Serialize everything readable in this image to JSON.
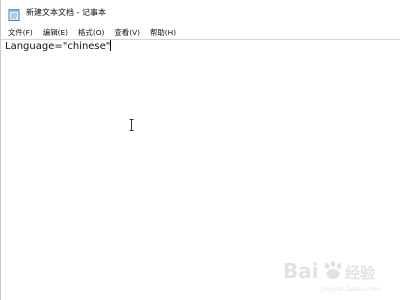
{
  "window": {
    "title": "新建文本文档 - 记事本"
  },
  "menu": {
    "items": [
      {
        "id": "file",
        "label": "文件(F)"
      },
      {
        "id": "edit",
        "label": "编辑(E)"
      },
      {
        "id": "format",
        "label": "格式(O)"
      },
      {
        "id": "view",
        "label": "查看(V)"
      },
      {
        "id": "help",
        "label": "帮助(H)"
      }
    ]
  },
  "editor": {
    "content": "Language=\"chinese\""
  },
  "icons": {
    "app": "notepad-icon",
    "cursor": "i-beam-cursor-icon",
    "watermark": "baidu-jingyan-watermark"
  }
}
